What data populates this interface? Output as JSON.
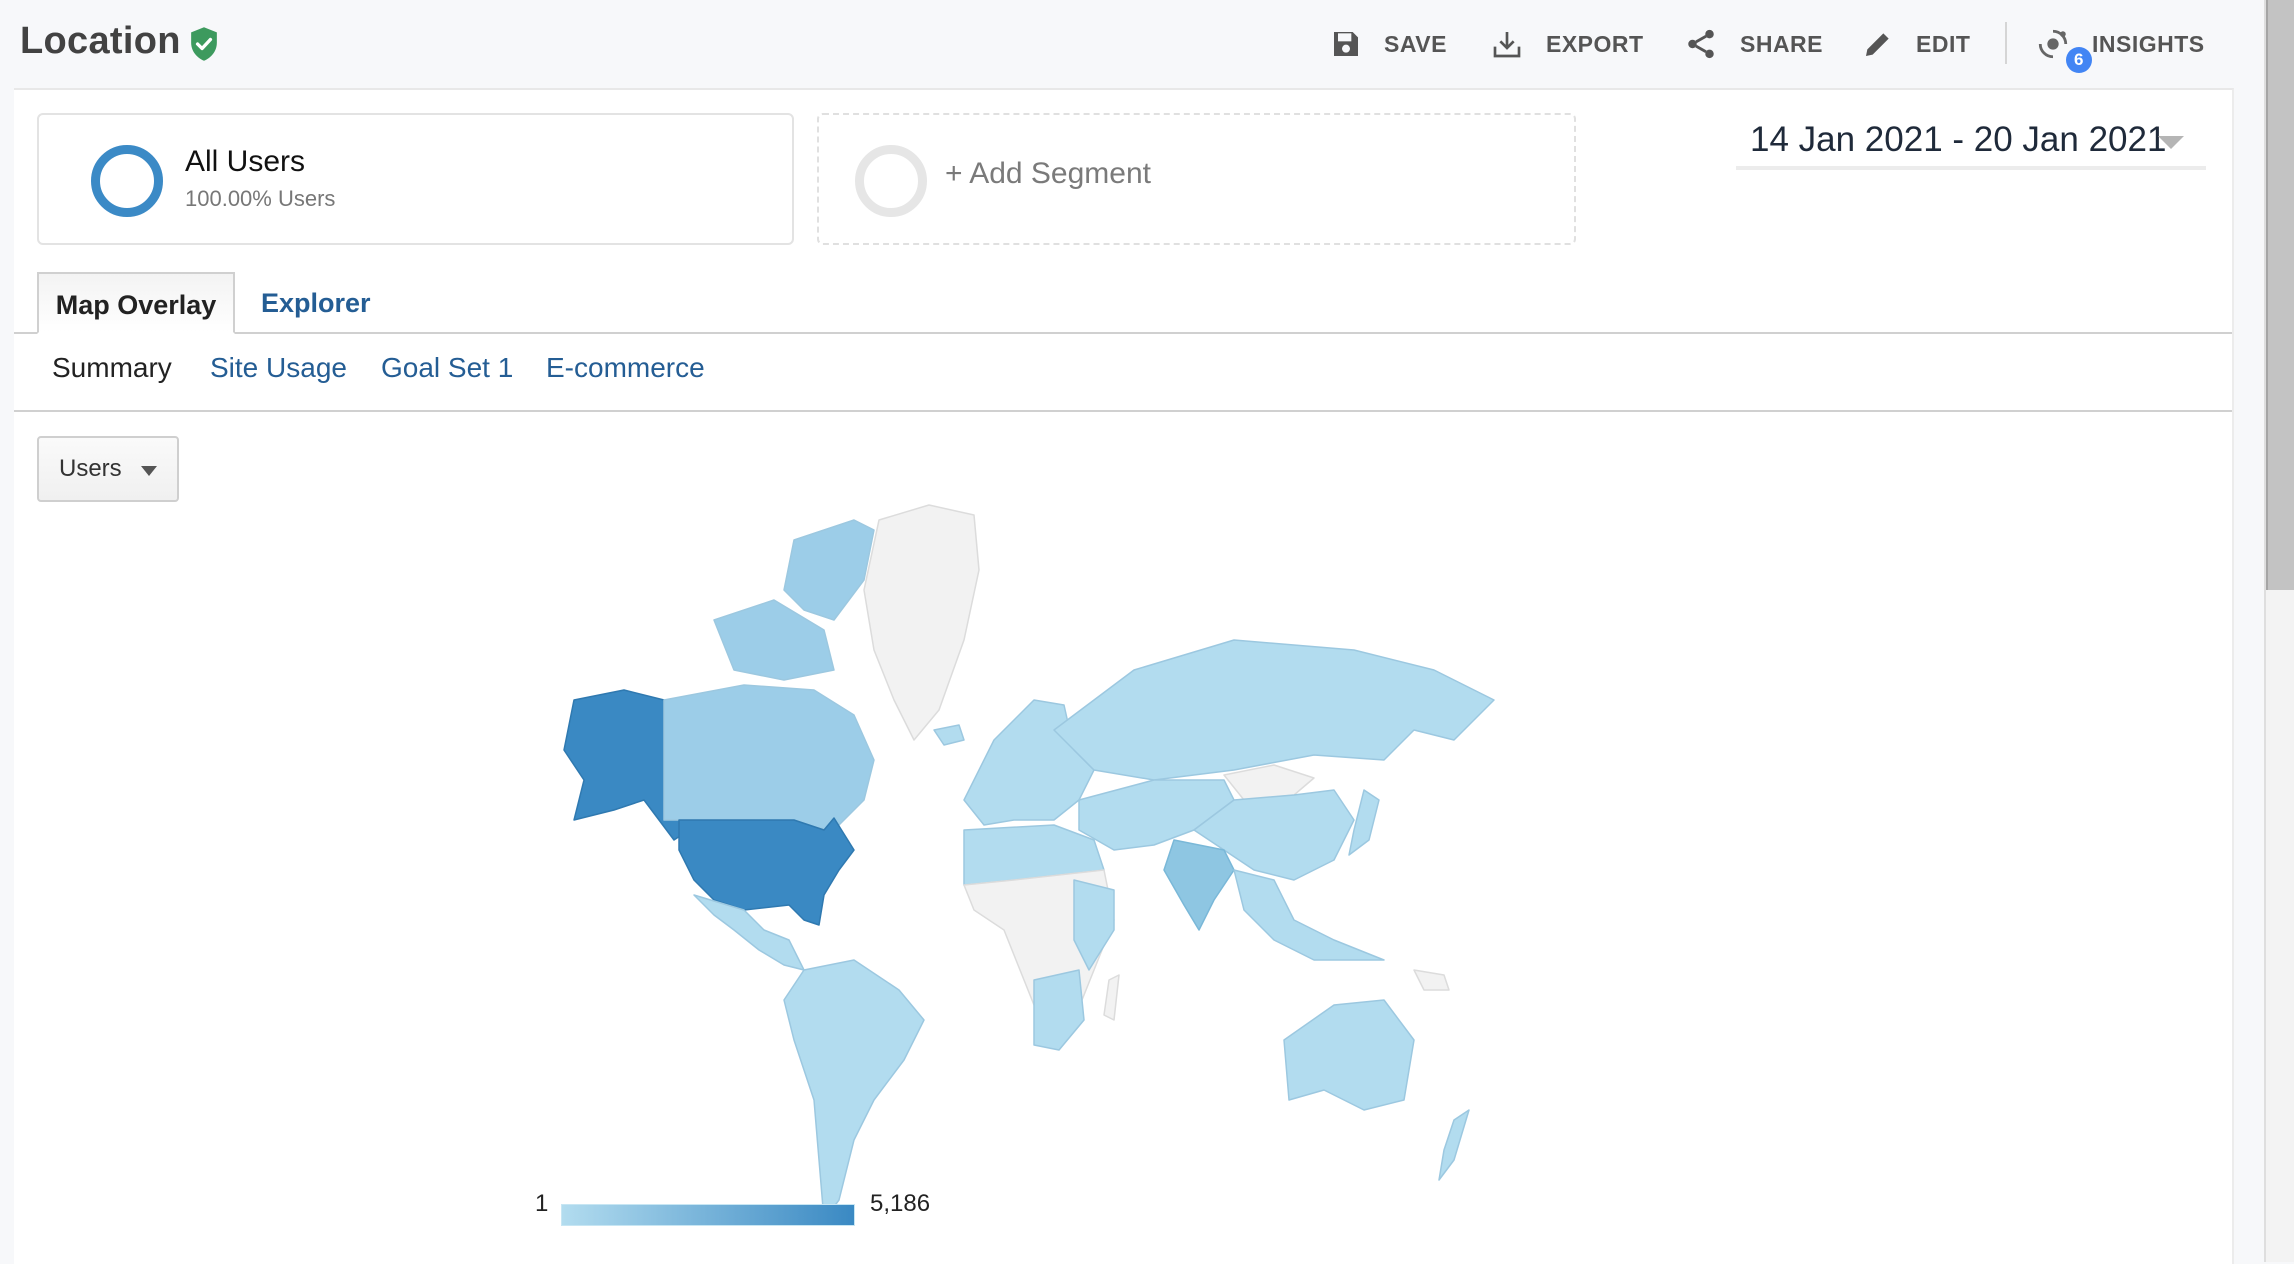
{
  "header": {
    "title": "Location",
    "verified_icon": "shield-check-icon",
    "toolbar": [
      {
        "label": "SAVE",
        "icon": "save-icon"
      },
      {
        "label": "EXPORT",
        "icon": "download-icon"
      },
      {
        "label": "SHARE",
        "icon": "share-icon"
      },
      {
        "label": "EDIT",
        "icon": "pencil-icon"
      },
      {
        "label": "INSIGHTS",
        "icon": "insights-icon",
        "badge": "6"
      }
    ]
  },
  "segments": {
    "active": {
      "name": "All Users",
      "detail": "100.00% Users",
      "color": "#3b8ac6"
    },
    "add_label": "+ Add Segment"
  },
  "date_range": {
    "label": "14 Jan 2021 - 20 Jan 2021"
  },
  "tabs": [
    {
      "label": "Map Overlay",
      "active": true
    },
    {
      "label": "Explorer",
      "active": false
    }
  ],
  "subtabs": [
    {
      "label": "Summary",
      "active": true
    },
    {
      "label": "Site Usage",
      "active": false
    },
    {
      "label": "Goal Set 1",
      "active": false
    },
    {
      "label": "E-commerce",
      "active": false
    }
  ],
  "metric_select": {
    "value": "Users"
  },
  "map": {
    "metric": "Users",
    "legend": {
      "min": "1",
      "max": "5,186",
      "min_color": "#b2dcef",
      "max_color": "#3a89c3",
      "no_data_color": "#f2f2f2"
    },
    "highlighted_regions": [
      {
        "name": "United States",
        "level": "highest"
      },
      {
        "name": "India",
        "level": "medium"
      }
    ]
  }
}
